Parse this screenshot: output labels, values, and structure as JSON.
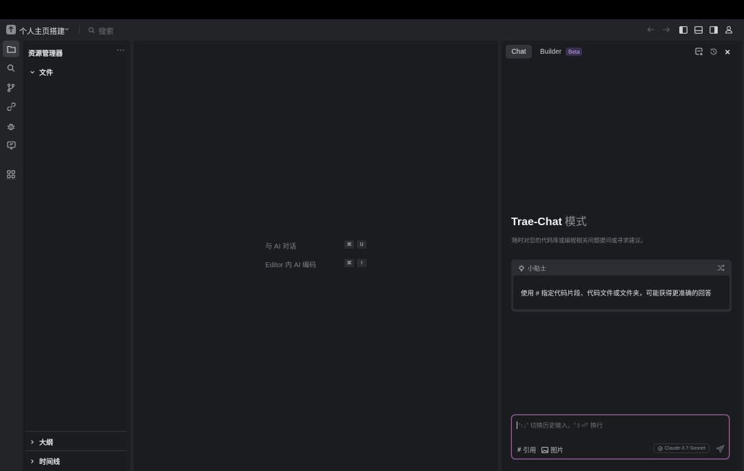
{
  "titlebar": {
    "project_name": "个人主页搭建",
    "search_placeholder": "搜索"
  },
  "explorer": {
    "title": "资源管理器",
    "more": "···",
    "section_files": "文件",
    "section_outline": "大纲",
    "section_timeline": "时间线"
  },
  "editor": {
    "hints": [
      {
        "label": "与 AI 对话",
        "keys": [
          "⌘",
          "U"
        ]
      },
      {
        "label": "Editor 内 AI 编码",
        "keys": [
          "⌘",
          "I"
        ]
      }
    ]
  },
  "chat": {
    "tab_chat": "Chat",
    "tab_builder": "Builder",
    "beta_badge": "Beta",
    "close": "×",
    "title": "Trae-Chat",
    "title_mode": "模式",
    "subtitle": "随时对您的代码库或编程相关问题提问或寻求建议。",
    "tips_label": "小贴士",
    "tips_text": "使用 # 指定代码片段、代码文件或文件夹，可能获得更准确的回答",
    "input_placeholder": "\"↑↓\" 切换历史输入，\"⇧⏎\" 换行",
    "ref_label": "引用",
    "image_label": "图片",
    "model_name": "Claude-3.7-Sonnet"
  },
  "colors": {
    "app_bg": "#232428",
    "panel_bg": "#1b1c1f",
    "input_border": "#a26c9a",
    "beta_text": "#b9a3e3"
  }
}
